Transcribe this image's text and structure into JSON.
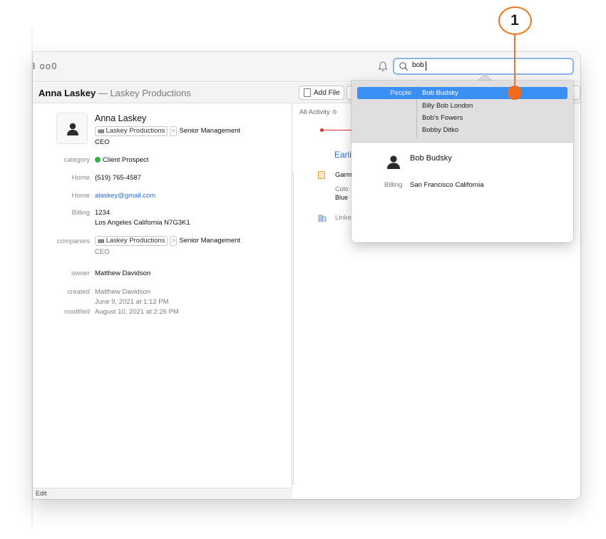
{
  "toolbar": {
    "view_glyphs": "8  oo0",
    "search_value": "bob"
  },
  "record_header": {
    "name": "Anna Laskey",
    "separator": " — ",
    "company": "Laskey Productions",
    "add_file_label": "Add File"
  },
  "contact": {
    "name": "Anna Laskey",
    "company_chip": "Laskey Productions",
    "chevron": ">",
    "department": "Senior Management",
    "title": "CEO",
    "fields": {
      "category_label": "category",
      "category_value": "Client Prospect",
      "phone_label": "Home",
      "phone_value": "(519) 765-4587",
      "email_label": "Home",
      "email_value": "alaskey@gmail.com",
      "billing_label": "Billing",
      "billing_line1": "1234",
      "billing_line2": "Los Angeles  California N7G3K1",
      "companies_label": "companies",
      "companies_chip": "Laskey Productions",
      "companies_department": "Senior Management",
      "companies_title": "CEO",
      "owner_label": "owner",
      "owner_value": "Matthew Davidson",
      "created_label": "created",
      "created_by": "Matthew Davidson",
      "created_date": "June 9, 2021 at 1:12 PM",
      "modified_label": "modified",
      "modified_date": "August 10, 2021 at 2:26 PM"
    },
    "edit_label": "Edit"
  },
  "activity": {
    "filter_label": "All Activity ≎",
    "earlier_label": "Earli",
    "item_title": "Garm",
    "item_field_label": "Colo",
    "item_field_value": "Blue",
    "linked_label": "Linke"
  },
  "search_results": {
    "selected_category": "People",
    "items": [
      "Bob Budsky",
      "Billy Bob London",
      "Bob's Fowers",
      "Bobby Ditko"
    ],
    "preview_name": "Bob Budsky",
    "preview_billing_label": "Billing",
    "preview_billing_value": "San Francisco California"
  },
  "callout": {
    "number": "1"
  },
  "colors": {
    "accent": "#3a8ff5",
    "callout": "#f2741b",
    "category_dot": "#2db34a",
    "link": "#2a6fd6"
  }
}
